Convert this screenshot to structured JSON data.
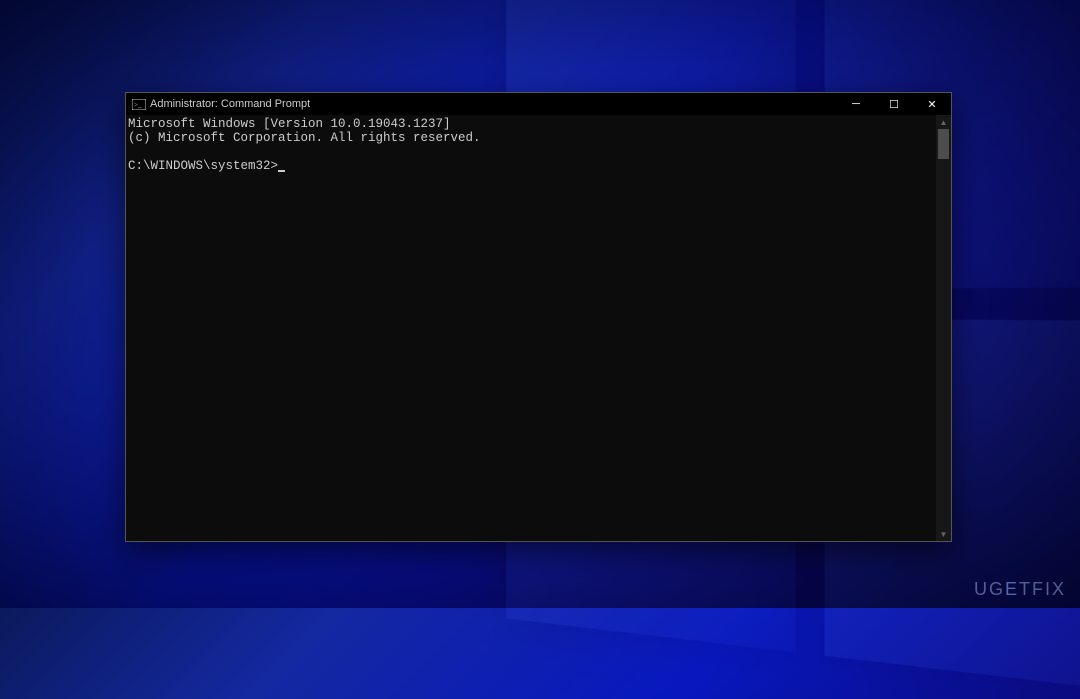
{
  "titlebar": {
    "title": "Administrator: Command Prompt",
    "icon_name": "cmd-icon"
  },
  "window_controls": {
    "minimize_glyph": "─",
    "maximize_glyph": "☐",
    "close_glyph": "✕"
  },
  "terminal": {
    "line1": "Microsoft Windows [Version 10.0.19043.1237]",
    "line2": "(c) Microsoft Corporation. All rights reserved.",
    "blank": "",
    "prompt": "C:\\WINDOWS\\system32>"
  },
  "scrollbar": {
    "up_glyph": "▲",
    "down_glyph": "▼"
  },
  "watermark": {
    "prefix": "UG",
    "accent": "E",
    "suffix": "TFIX"
  }
}
